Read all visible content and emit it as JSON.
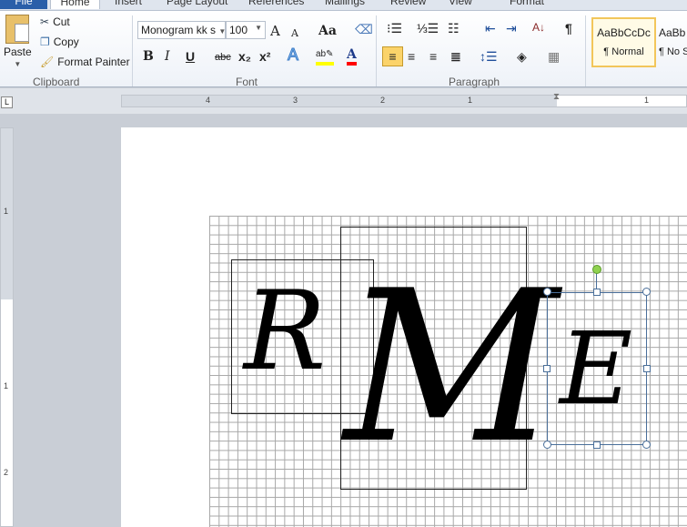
{
  "tabs": [
    "File",
    "Home",
    "Insert",
    "Page Layout",
    "References",
    "Mailings",
    "Review",
    "View",
    "Format"
  ],
  "clipboard": {
    "paste": "Paste",
    "cut": "Cut",
    "copy": "Copy",
    "format_painter": "Format Painter",
    "label": "Clipboard"
  },
  "font": {
    "name": "Monogram kk s",
    "size": "100",
    "label": "Font",
    "bold": "B",
    "italic": "I",
    "underline": "U",
    "strike": "abc",
    "sub": "x₂",
    "sup": "x²",
    "grow": "A",
    "shrink": "A",
    "case": "Aa",
    "color": "A"
  },
  "paragraph": {
    "label": "Paragraph",
    "pilcrow": "¶"
  },
  "styles": {
    "normal_preview": "AaBbCcDc",
    "normal": "¶ Normal",
    "nospace_preview": "AaBb",
    "nospace": "¶ No S"
  },
  "ruler": {
    "h": [
      "4",
      "3",
      "2",
      "1",
      "1"
    ],
    "v": [
      "1",
      "1",
      "2"
    ]
  },
  "document": {
    "left": "R",
    "center": "M",
    "right": "E"
  },
  "colors": {
    "accent": "#2a5fa9",
    "highlight": "#ffff00",
    "fontcolor": "#ff0000"
  }
}
